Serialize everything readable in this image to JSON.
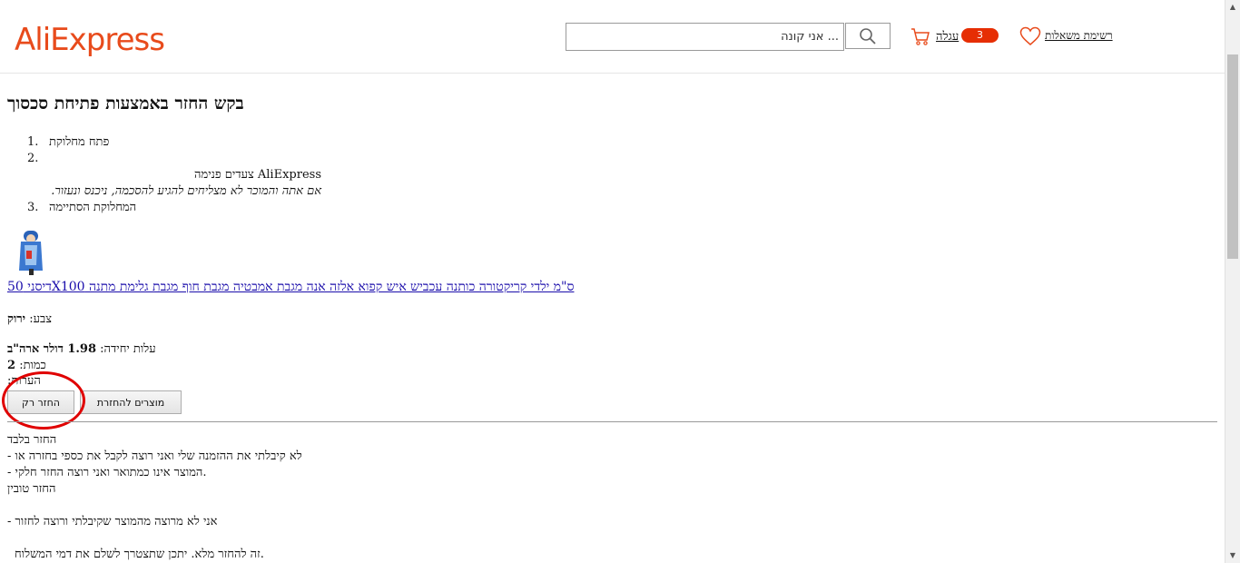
{
  "header": {
    "logo": "AliExpress",
    "search_placeholder": "... אני קונה",
    "cart_label": "עגלה",
    "cart_count": "3",
    "wishlist_label": "רשימת משאלות"
  },
  "page": {
    "title": "בקש החזר באמצעות פתיחת סכסוך",
    "steps": [
      {
        "num": "1.",
        "text": "פתח מחלוקת"
      },
      {
        "num": "2.",
        "text": "",
        "line1": "AliExpress צעדים פנימה",
        "line2": "אם אתה והמוכר לא מצליחים להגיע להסכמה, ניכנס ונעזור."
      },
      {
        "num": "3.",
        "text": "המחלוקת הסתיימה"
      }
    ],
    "product_title": "ס\"מ ילדי קריקטורה כותנה עכביש איש קפוא אלזה אנה מגבת אמבטיה מגבת חוף מגבת גלימת מתנה X100דיסני 50",
    "color_label": "צבע:",
    "color_value": "ירוק",
    "unit_cost_label": "עלות יחידה:",
    "unit_cost_value": "1.98 דולר ארה\"ב",
    "quantity_label": "כמות:",
    "quantity_value": "2",
    "notes_label": "הערות:",
    "refund_only_button": "החזר רק",
    "return_products_button": "מוצרים להחזרת"
  },
  "notes": {
    "l1": "החזר בלבד",
    "l2": "- לא קיבלתי את ההזמנה שלי ואני רוצה לקבל את כספי בחזרה או",
    "l3": "- המוצר אינו כמתואר ואני רוצה החזר חלקי.",
    "l4": "החזר טובין",
    "l5": "- אני לא מרוצה מהמוצר שקיבלתי ורוצה לחזור",
    "l6": "זה להחזר מלא. יתכן שתצטרך לשלם את דמי המשלוח."
  }
}
